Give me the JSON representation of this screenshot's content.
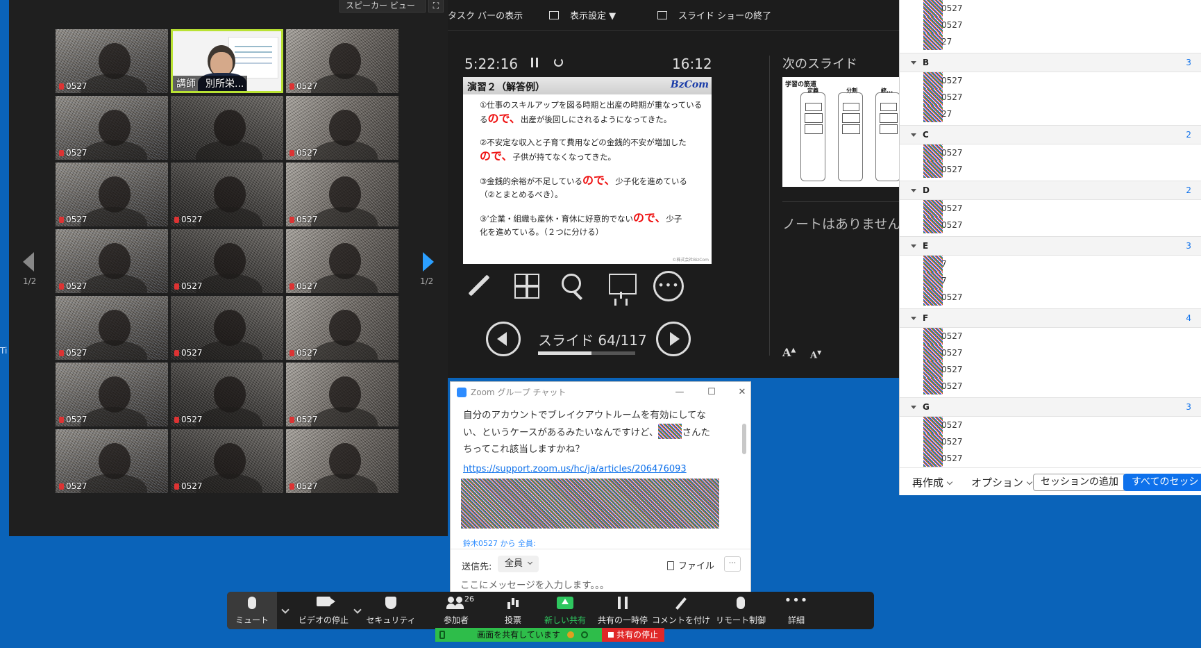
{
  "gallery": {
    "view_button": "スピーカー ビュー",
    "page_left": "1/2",
    "page_right": "1/2",
    "active_speaker_name": "講師　別所栄...",
    "tiles": [
      {
        "name": "0527",
        "active": false
      },
      {
        "name": "講師　別所栄...",
        "active": true
      },
      {
        "name": "0527",
        "active": false
      },
      {
        "name": "0527",
        "active": false
      },
      {
        "name": "",
        "active": false
      },
      {
        "name": "0527",
        "active": false
      },
      {
        "name": "0527",
        "active": false
      },
      {
        "name": "0527",
        "active": false
      },
      {
        "name": "0527",
        "active": false
      },
      {
        "name": "0527",
        "active": false
      },
      {
        "name": "0527",
        "active": false
      },
      {
        "name": "0527",
        "active": false
      },
      {
        "name": "0527",
        "active": false
      },
      {
        "name": "0527",
        "active": false
      },
      {
        "name": "0527",
        "active": false
      },
      {
        "name": "0527",
        "active": false
      },
      {
        "name": "0527",
        "active": false
      },
      {
        "name": "0527",
        "active": false
      },
      {
        "name": "0527",
        "active": false
      },
      {
        "name": "0527",
        "active": false
      },
      {
        "name": "0527",
        "active": false
      }
    ]
  },
  "presenter": {
    "toolbar": {
      "taskbar": "タスク バーの表示",
      "display_settings": "表示設定 ▼",
      "end_show": "スライド ショーの終了"
    },
    "elapsed": "5:22:16",
    "clock": "16:12",
    "slide": {
      "title": "演習２（解答例）",
      "logo": "BzCom",
      "p1a": "①仕事のスキルアップを図る時期と出産の時期が重なっている",
      "p1b": "る",
      "p1red": "ので、",
      "p1c": "出産が後回しにされるようになってきた。",
      "p2a": "②不安定な収入と子育て費用などの金銭的不安が増加した",
      "p2red": "ので、",
      "p2b": "子供が持てなくなってきた。",
      "p3a": "③金銭的余裕が不足している",
      "p3red": "ので、",
      "p3b": "少子化を進めている",
      "p3c": "（②とまとめるべき）。",
      "p4a": "③’企業・組織も産休・育休に好意的でない",
      "p4red": "ので、",
      "p4b": "少子",
      "p4c": "化を進めている。（２つに分ける）",
      "copyright": "©株式会社BizCom"
    },
    "slide_counter": "スライド 64/117",
    "progress_fraction": 0.547,
    "next_label": "次のスライド",
    "next_thumb": {
      "title": "学習の筋道",
      "col1": "定義",
      "col2": "分割",
      "col3": "統..."
    },
    "notes": "ノートはありません。",
    "font_up": "A",
    "font_down": "A"
  },
  "breakout": {
    "rooms": [
      {
        "name": "",
        "count": "",
        "members": [
          "0527",
          "0527",
          "27"
        ]
      },
      {
        "name": "B",
        "count": "3",
        "members": [
          "0527",
          "0527",
          "27"
        ]
      },
      {
        "name": "C",
        "count": "2",
        "members": [
          "0527",
          "0527"
        ]
      },
      {
        "name": "D",
        "count": "2",
        "members": [
          "0527",
          "0527"
        ]
      },
      {
        "name": "E",
        "count": "3",
        "members": [
          "7",
          "7",
          "0527"
        ]
      },
      {
        "name": "F",
        "count": "4",
        "members": [
          "0527",
          "0527",
          "0527",
          "0527"
        ]
      },
      {
        "name": "G",
        "count": "3",
        "members": [
          "0527",
          "0527",
          "0527"
        ]
      }
    ],
    "footer": {
      "recreate": "再作成",
      "options": "オプション",
      "add_session": "セッションの追加",
      "all_sessions": "すべてのセッシ"
    }
  },
  "chat": {
    "title": "Zoom グループ チャット",
    "minimize": "—",
    "maximize": "☐",
    "close": "✕",
    "msg_line1": "自分のアカウントでブレイクアウトルームを有効にしてな",
    "msg_line2a": "い、というケースがあるみたいなんですけど、",
    "msg_line2b": "さんた",
    "msg_line3": "ちってこれ該当しますかね？",
    "link": "https://support.zoom.us/hc/ja/articles/206476093",
    "from_line": "鈴木0527 から 全員:",
    "send_to_label": "送信先:",
    "send_to_value": "全員",
    "file_label": "ファイル",
    "more_label": "···",
    "input_placeholder": "ここにメッセージを入力します。。。"
  },
  "controls": {
    "mute": "ミュート",
    "video": "ビデオの停止",
    "security": "セキュリティ",
    "participants": "参加者",
    "participants_count": "26",
    "poll": "投票",
    "new_share": "新しい共有",
    "pause_share": "共有の一時停",
    "annotate": "コメントを付け",
    "remote": "リモート制御",
    "more": "詳細",
    "more_dots": "•••"
  },
  "sharing_status": "画面を共有しています",
  "stop_share": "共有の停止",
  "desktop_label": "Ti",
  "colors": {
    "desktop": "#0a63b9",
    "accent_blue": "#0e71eb",
    "share_green": "#2ec75f",
    "stop_red": "#e02828",
    "active_speaker": "#b9e234"
  }
}
